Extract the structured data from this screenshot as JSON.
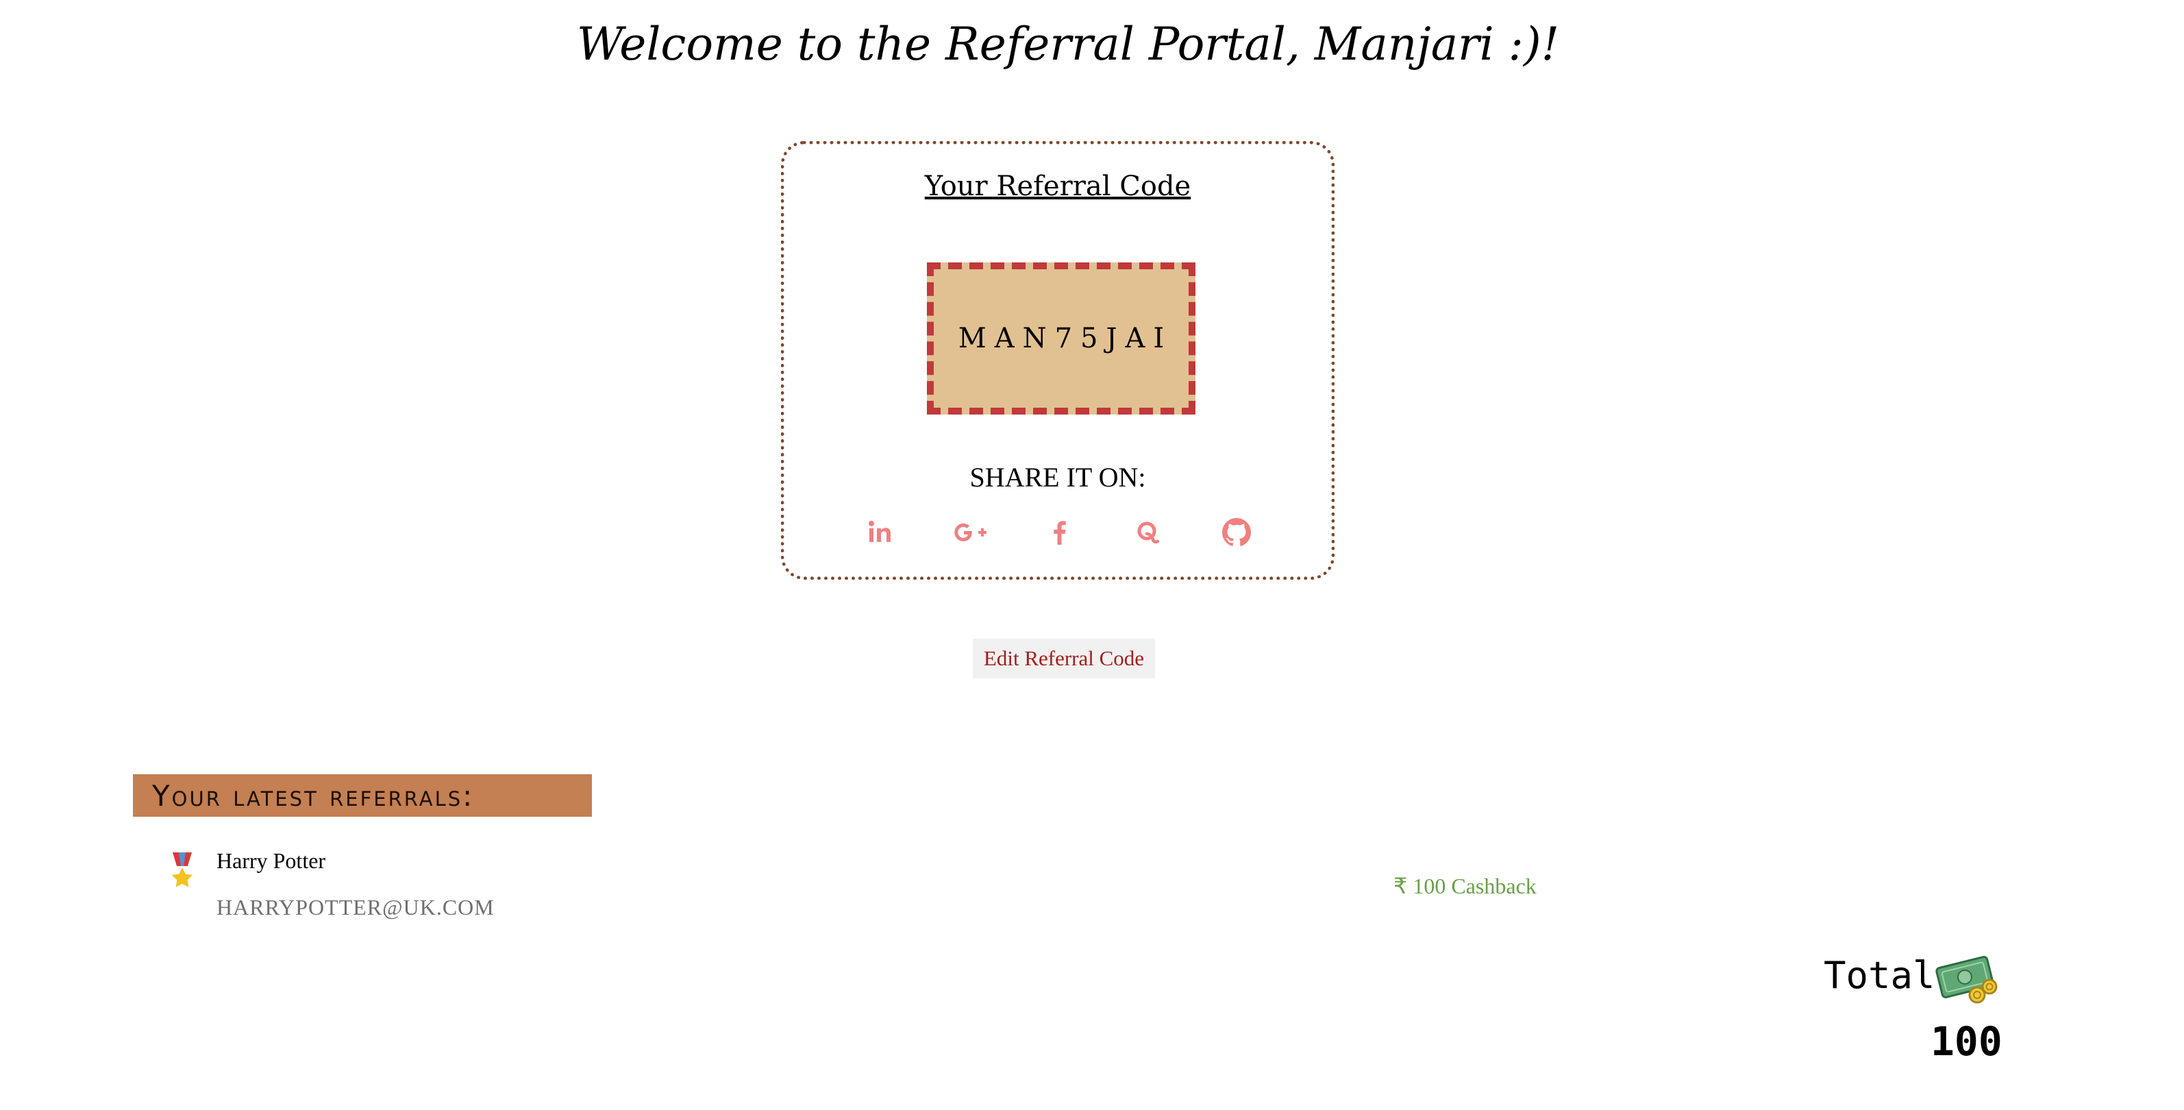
{
  "header": {
    "welcome": "Welcome to the Referral Portal, Manjari :)!"
  },
  "referral_card": {
    "title": "Your Referral Code",
    "code": "MAN75JAI",
    "share_label": "SHARE IT ON:",
    "share_icons": [
      "linkedin-icon",
      "google-plus-icon",
      "facebook-icon",
      "quora-icon",
      "github-icon"
    ]
  },
  "actions": {
    "edit_label": "Edit Referral Code"
  },
  "referrals": {
    "heading": "Your latest referrals:",
    "items": [
      {
        "name": "Harry Potter",
        "email": "HARRYPOTTER@UK.COM",
        "cashback": "₹ 100 Cashback",
        "icon": "medal-icon"
      }
    ]
  },
  "total": {
    "label": "Total",
    "value": "100",
    "icon": "money-icon"
  },
  "colors": {
    "share_icon": "#f08080",
    "code_border": "#c0393b",
    "code_background": "#e1c191",
    "heading_background": "#c47f52",
    "cashback": "#6a9f4a",
    "edit_text": "#a0201e"
  }
}
